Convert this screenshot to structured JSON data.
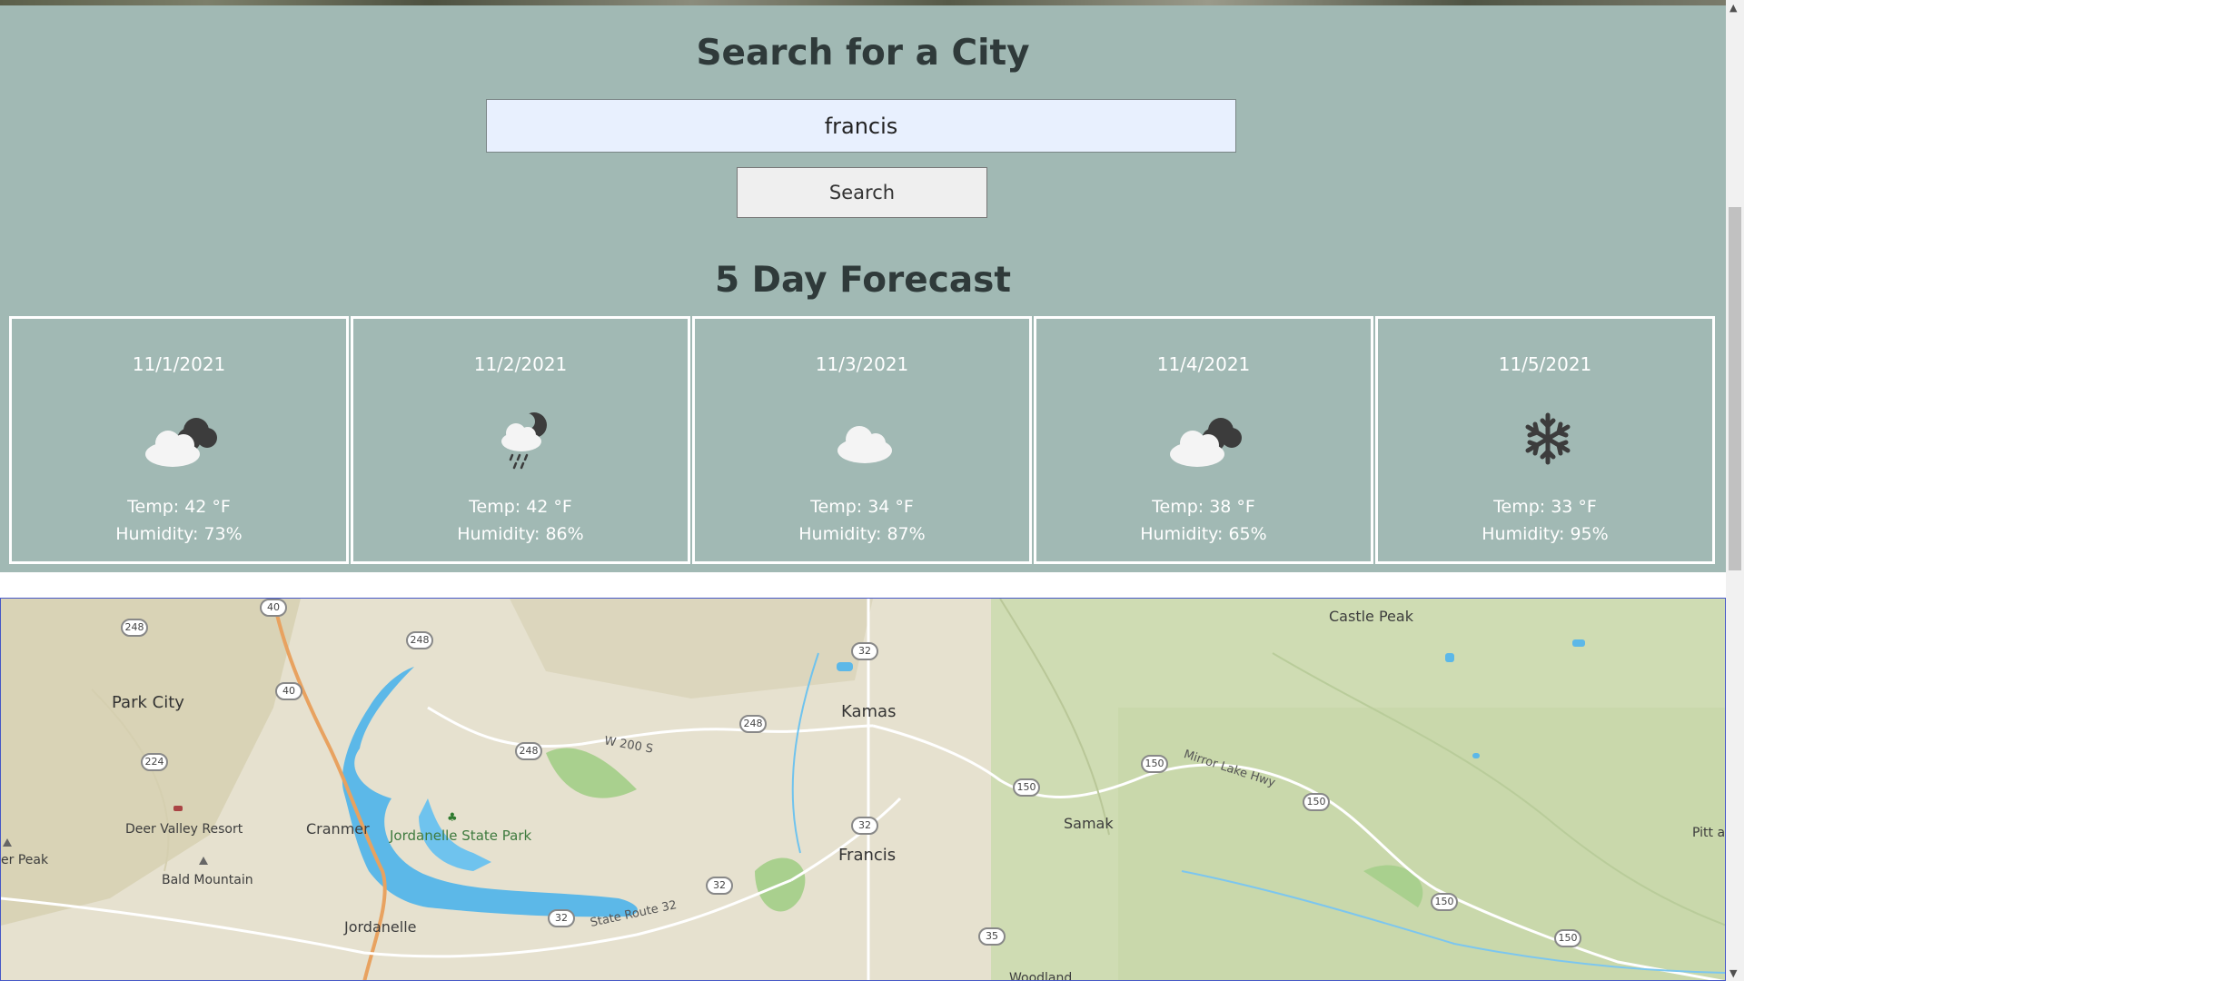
{
  "search": {
    "title": "Search for a City",
    "input_value": "francis",
    "button_label": "Search"
  },
  "forecast": {
    "title": "5 Day Forecast",
    "days": [
      {
        "date": "11/1/2021",
        "icon": "partly-cloudy-night-icon",
        "temp": "Temp: 42 °F",
        "humidity": "Humidity: 73%"
      },
      {
        "date": "11/2/2021",
        "icon": "night-rain-icon",
        "temp": "Temp: 42 °F",
        "humidity": "Humidity: 86%"
      },
      {
        "date": "11/3/2021",
        "icon": "cloud-icon",
        "temp": "Temp: 34 °F",
        "humidity": "Humidity: 87%"
      },
      {
        "date": "11/4/2021",
        "icon": "partly-cloudy-night-icon",
        "temp": "Temp: 38 °F",
        "humidity": "Humidity: 65%"
      },
      {
        "date": "11/5/2021",
        "icon": "snowflake-icon",
        "temp": "Temp: 33 °F",
        "humidity": "Humidity: 95%"
      }
    ]
  },
  "map": {
    "places": {
      "castle_peak": "Castle Peak",
      "park_city": "Park City",
      "kamas": "Kamas",
      "deer_valley": "Deer Valley Resort",
      "cranmer": "Cranmer",
      "jordanelle_park": "Jordanelle State Park",
      "samak": "Samak",
      "francis": "Francis",
      "peak_left": "er Peak",
      "bald_mountain": "Bald Mountain",
      "jordanelle": "Jordanelle",
      "woodland": "Woodland",
      "pitt": "Pitt ar"
    },
    "roads": {
      "w200s": "W 200 S",
      "mirror_lake": "Mirror Lake Hwy",
      "state_route_32": "State Route 32"
    },
    "shields": {
      "s248a": "248",
      "s40a": "40",
      "s248b": "248",
      "s32a": "32",
      "s40b": "40",
      "s248c": "248",
      "s248d": "248",
      "s224": "224",
      "s150a": "150",
      "s150b": "150",
      "s150c": "150",
      "s32b": "32",
      "s32c": "32",
      "s32d": "32",
      "s150d": "150",
      "s35": "35",
      "s150e": "150"
    }
  },
  "colors": {
    "panel": "#a1b9b4",
    "card_border": "#ffffff",
    "input_bg": "#e8f0fe",
    "water": "#5cb8e8",
    "park": "#a9d08e"
  }
}
